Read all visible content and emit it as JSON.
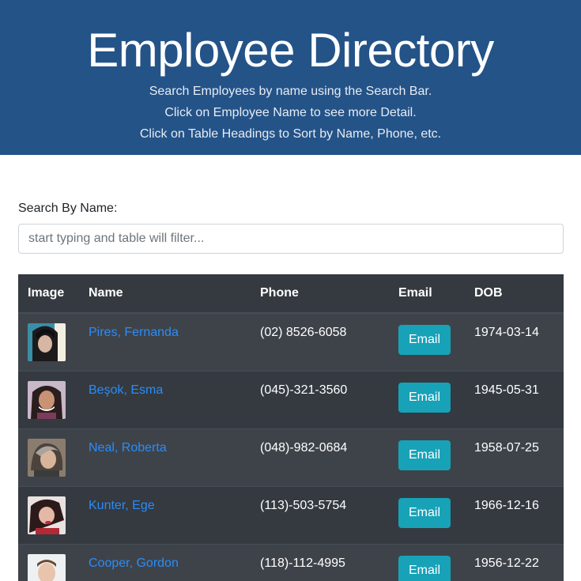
{
  "header": {
    "title": "Employee Directory",
    "line1": "Search Employees by name using the Search Bar.",
    "line2": "Click on Employee Name to see more Detail.",
    "line3": "Click on Table Headings to Sort by Name, Phone, etc."
  },
  "search": {
    "label": "Search By Name:",
    "placeholder": "start typing and table will filter...",
    "value": ""
  },
  "table": {
    "headers": {
      "image": "Image",
      "name": "Name",
      "phone": "Phone",
      "email": "Email",
      "dob": "DOB"
    },
    "rows": [
      {
        "name": "Pires, Fernanda",
        "phone": "(02) 8526-6058",
        "email_label": "Email",
        "dob": "1974-03-14"
      },
      {
        "name": "Beşok, Esma",
        "phone": "(045)-321-3560",
        "email_label": "Email",
        "dob": "1945-05-31"
      },
      {
        "name": "Neal, Roberta",
        "phone": "(048)-982-0684",
        "email_label": "Email",
        "dob": "1958-07-25"
      },
      {
        "name": "Kunter, Ege",
        "phone": "(113)-503-5754",
        "email_label": "Email",
        "dob": "1966-12-16"
      },
      {
        "name": "Cooper, Gordon",
        "phone": "(118)-112-4995",
        "email_label": "Email",
        "dob": "1956-12-22"
      }
    ]
  },
  "colors": {
    "header_bg": "#245388",
    "table_dark": "#343a40",
    "link": "#2b8cf7",
    "email_button": "#17a2b8"
  }
}
